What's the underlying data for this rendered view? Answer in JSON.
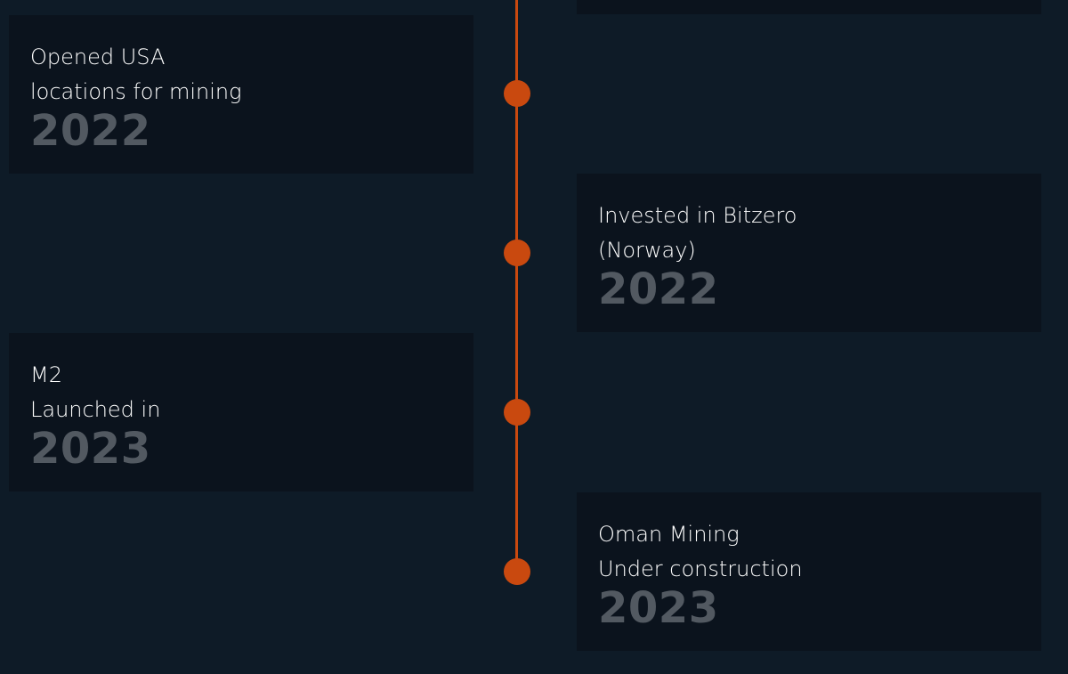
{
  "timeline": {
    "accent_color": "#c9490f",
    "events": [
      {
        "side": "left",
        "line1": "Opened USA",
        "line2": "locations for mining",
        "year": "2022"
      },
      {
        "side": "right",
        "line1": "Invested in Bitzero",
        "line2": "(Norway)",
        "year": "2022"
      },
      {
        "side": "left",
        "line1": "M2",
        "line2": "Launched in",
        "year": "2023"
      },
      {
        "side": "right",
        "line1": "Oman Mining",
        "line2": "Under construction",
        "year": "2023"
      }
    ]
  }
}
